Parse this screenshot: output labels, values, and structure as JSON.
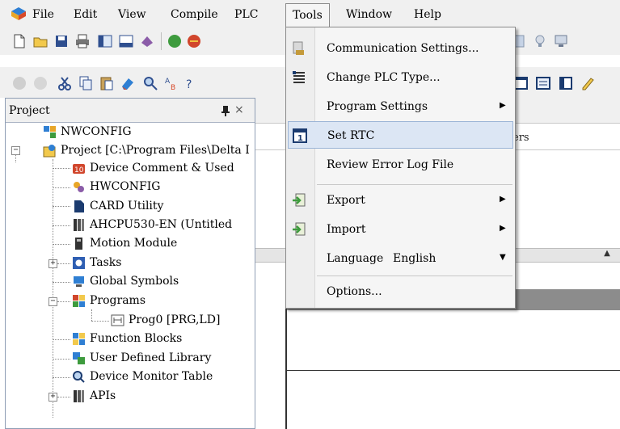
{
  "menubar": {
    "items": [
      "File",
      "Edit",
      "View",
      "Compile",
      "PLC",
      "Tools",
      "Window",
      "Help"
    ],
    "open_menu": "Tools"
  },
  "project_panel": {
    "title": "Project",
    "close_glyph": "×",
    "tree": [
      "NWCONFIG",
      "Project [C:\\Program Files\\Delta I",
      "Device Comment & Used",
      "HWCONFIG",
      "CARD Utility",
      "AHCPU530-EN  (Untitled",
      "Motion Module",
      "Tasks",
      "Global Symbols",
      "Programs",
      "Prog0 [PRG,LD]",
      "Function Blocks",
      "User Defined Library",
      "Device Monitor Table",
      "APIs"
    ]
  },
  "workspace": {
    "tab_text": "ers"
  },
  "tools_menu": {
    "items": [
      {
        "label": "Communication Settings...",
        "icon": "communication-icon",
        "submenu": false
      },
      {
        "label": "Change PLC Type...",
        "icon": "change-plc-icon",
        "submenu": false
      },
      {
        "label": "Program Settings",
        "icon": "",
        "submenu": true
      },
      {
        "label": "Set RTC",
        "icon": "rtc-calendar-icon",
        "submenu": false,
        "highlighted": true
      },
      {
        "label": "Review Error Log File",
        "icon": "",
        "submenu": false
      },
      {
        "label": "Export",
        "icon": "export-icon",
        "submenu": true
      },
      {
        "label": "Import",
        "icon": "import-icon",
        "submenu": true
      },
      {
        "label": "Language",
        "icon": "",
        "submenu": true,
        "value": "English"
      },
      {
        "label": "Options...",
        "icon": "",
        "submenu": false
      }
    ],
    "arrow_glyph": "▶",
    "down_glyph": "▼"
  },
  "colors": {
    "highlight_bg": "#dce6f4",
    "highlight_border": "#9bb4d6",
    "menu_bg": "#f5f5f5",
    "chrome_bg": "#f0f0f0"
  }
}
